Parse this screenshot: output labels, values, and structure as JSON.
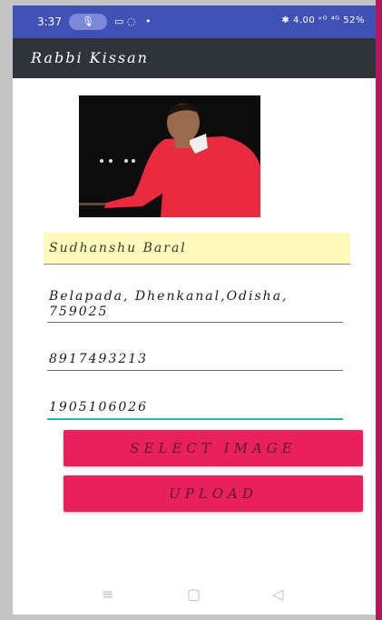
{
  "status_bar": {
    "time": "3:37",
    "mic_icon": "mic-icon",
    "right_text": "✱ 4.00 ᵛᴼ ⁴ᴳ 52%"
  },
  "app_bar": {
    "title": "Rabbi Kissan"
  },
  "form": {
    "name": "Sudhanshu Baral",
    "address_line1": "Belapada, Dhenkanal,Odisha,",
    "address_line2": "759025",
    "phone": "8917493213",
    "id": "1905106026"
  },
  "buttons": {
    "select_image": "SELECT IMAGE",
    "upload": "UPLOAD"
  },
  "colors": {
    "status_bar": "#3f51b5",
    "app_bar": "#2e3439",
    "button": "#e8205e",
    "name_highlight": "#fffbbf",
    "focus_underline": "#27b3b8"
  }
}
